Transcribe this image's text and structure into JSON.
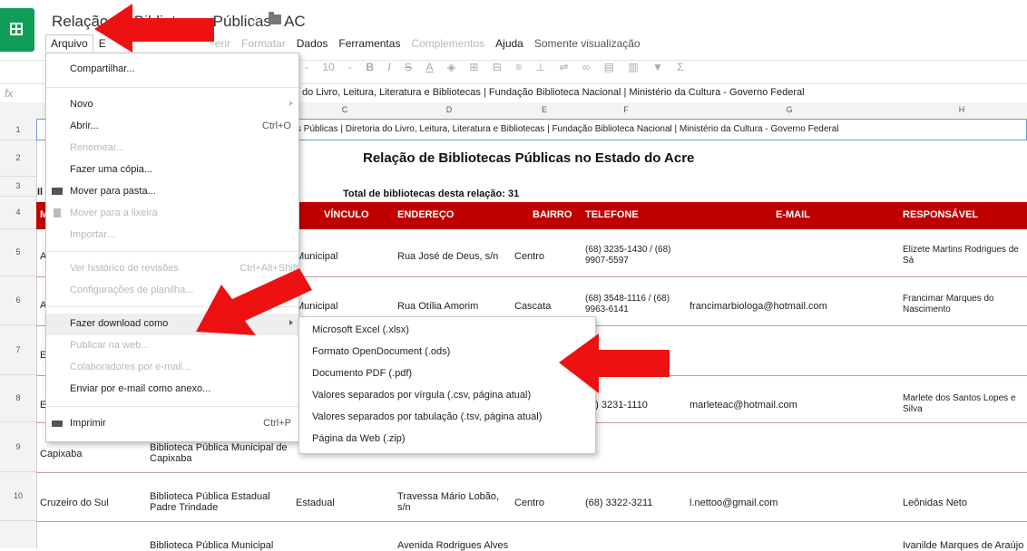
{
  "window": {
    "title": "Relação de Bibliotecas Públicas - AC"
  },
  "menubar": {
    "items": [
      {
        "label": "Arquivo"
      },
      {
        "label": "E"
      },
      {
        "label": "erir"
      },
      {
        "label": "Formatar"
      },
      {
        "label": "Dados"
      },
      {
        "label": "Ferramentas"
      },
      {
        "label": "Complementos"
      },
      {
        "label": "Ajuda"
      },
      {
        "label": "Somente visualização"
      }
    ]
  },
  "toolbar": {
    "font_size": "10"
  },
  "formula_bar": {
    "fx": "fx",
    "value": "do Livro, Leitura, Literatura e Bibliotecas | Fundação Biblioteca Nacional | Ministério da Cultura - Governo Federal"
  },
  "columns": [
    "C",
    "D",
    "E",
    "F",
    "G",
    "H"
  ],
  "rows": [
    "1",
    "2",
    "3",
    "4",
    "5",
    "6",
    "7",
    "8",
    "9",
    "10"
  ],
  "sheet": {
    "row1_text": "s Públicas | Diretoria do Livro, Leitura, Literatura e Bibliotecas | Fundação Biblioteca Nacional | Ministério da Cultura - Governo Federal",
    "heading": "Relação de Bibliotecas Públicas no Estado do Acre",
    "total": "Total de bibliotecas desta relação: 31",
    "row3_partial": "Il",
    "headers": {
      "vinculo": "VÍNCULO",
      "endereco": "ENDEREÇO",
      "bairro": "BAIRRO",
      "telefone": "TELEFONE",
      "email": "E-MAIL",
      "responsavel": "RESPONSÁVEL",
      "left_partial": "M"
    },
    "row5": {
      "a": "A",
      "vinculo": "Municipal",
      "endereco": "Rua José de Deus, s/n",
      "bairro": "Centro",
      "telefone": "(68) 3235-1430 / (68) 9907-5597",
      "responsavel": "Elizete Martins Rodrigues de Sá"
    },
    "row6": {
      "a": "A",
      "vinculo": "Municipal",
      "endereco": "Rua Otília Amorim",
      "bairro": "Cascata",
      "telefone": "(68) 3548-1116 / (68) 9963-6141",
      "email": "francimarbiologa@hotmail.com",
      "responsavel": "Francimar Marques do Nascimento"
    },
    "row7": {
      "a": "E"
    },
    "row8": {
      "a": "E",
      "telefone": "8) 3231-1110",
      "email": "marleteac@hotmail.com",
      "responsavel": "Marlete dos Santos Lopes e Silva"
    },
    "row9": {
      "a": "Capixaba",
      "b": "Biblioteca Pública Municipal de Capixaba"
    },
    "row10": {
      "a": "Cruzeiro do Sul",
      "b": "Biblioteca Pública Estadual Padre Trindade",
      "vinculo": "Estadual",
      "endereco": "Travessa Mário Lobão, s/n",
      "bairro": "Centro",
      "telefone": "(68) 3322-3211",
      "email": "l.nettoo@gmail.com",
      "responsavel": "Leônidas Neto"
    },
    "row11": {
      "b": "Biblioteca Pública Municipal",
      "endereco": "Avenida Rodrigues Alves",
      "responsavel": "Ivanilde Marques de Araújo"
    }
  },
  "file_menu": {
    "items": [
      {
        "label": "Compartilhar...",
        "shortcut": "",
        "disabled": false
      },
      {
        "label": "Novo",
        "shortcut": "",
        "disabled": false
      },
      {
        "label": "Abrir...",
        "shortcut": "Ctrl+O",
        "disabled": false
      },
      {
        "label": "Renomear...",
        "shortcut": "",
        "disabled": true
      },
      {
        "label": "Fazer uma cópia...",
        "shortcut": "",
        "disabled": false
      },
      {
        "label": "Mover para pasta...",
        "shortcut": "",
        "disabled": false
      },
      {
        "label": "Mover para a lixeira",
        "shortcut": "",
        "disabled": true
      },
      {
        "label": "Importar...",
        "shortcut": "",
        "disabled": true
      },
      {
        "label": "Ver histórico de revisões",
        "shortcut": "Ctrl+Alt+Shift",
        "disabled": true
      },
      {
        "label": "Configurações de planilha...",
        "shortcut": "",
        "disabled": true
      },
      {
        "label": "Fazer download como",
        "shortcut": "",
        "disabled": false
      },
      {
        "label": "Publicar na web...",
        "shortcut": "",
        "disabled": true
      },
      {
        "label": "Colaboradores por e-mail...",
        "shortcut": "",
        "disabled": true
      },
      {
        "label": "Enviar por e-mail como anexo...",
        "shortcut": "",
        "disabled": false
      },
      {
        "label": "Imprimir",
        "shortcut": "Ctrl+P",
        "disabled": false
      }
    ]
  },
  "download_submenu": {
    "items": [
      {
        "label": "Microsoft Excel (.xlsx)"
      },
      {
        "label": "Formato OpenDocument (.ods)"
      },
      {
        "label": "Documento PDF (.pdf)"
      },
      {
        "label": "Valores separados por vírgula (.csv, página atual)"
      },
      {
        "label": "Valores separados por tabulação (.tsv, página atual)"
      },
      {
        "label": "Página da Web (.zip)"
      }
    ]
  },
  "colors": {
    "brand_green": "#0f9d58",
    "header_red": "#c00000",
    "arrow_red": "#ee1111"
  },
  "icons": [
    "sheets-logo-icon",
    "star-icon",
    "folder-icon",
    "folder-icon-menu",
    "trash-icon",
    "printer-icon",
    "submenu-arrow-icon"
  ]
}
